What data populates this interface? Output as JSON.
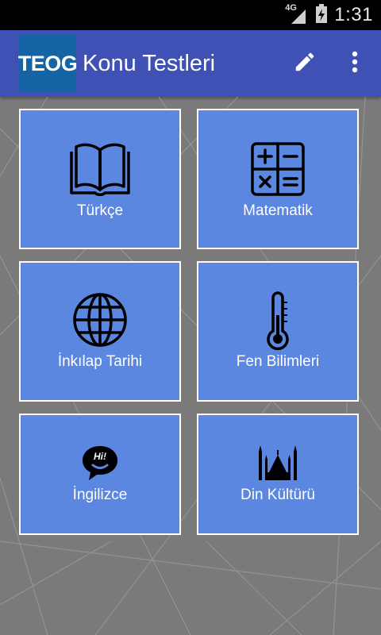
{
  "status_bar": {
    "network": "4G",
    "time": "1:31"
  },
  "app_bar": {
    "logo_text": "TEOG",
    "title": "Konu Testleri",
    "edit_icon": "pencil-icon",
    "menu_icon": "more-vert-icon"
  },
  "subjects": [
    {
      "label": "Türkçe",
      "icon": "open-book-icon"
    },
    {
      "label": "Matematik",
      "icon": "calculator-icon"
    },
    {
      "label": "İnkılap Tarihi",
      "icon": "globe-icon"
    },
    {
      "label": "Fen Bilimleri",
      "icon": "thermometer-icon"
    },
    {
      "label": "İngilizce",
      "icon": "speech-bubble-hi-icon",
      "icon_text": "Hi!"
    },
    {
      "label": "Din Kültürü",
      "icon": "mosque-icon"
    }
  ],
  "colors": {
    "app_bar": "#3f51b5",
    "tile": "#5b87e0",
    "background": "#7a7a7a",
    "logo_bg": "#1565a6"
  }
}
